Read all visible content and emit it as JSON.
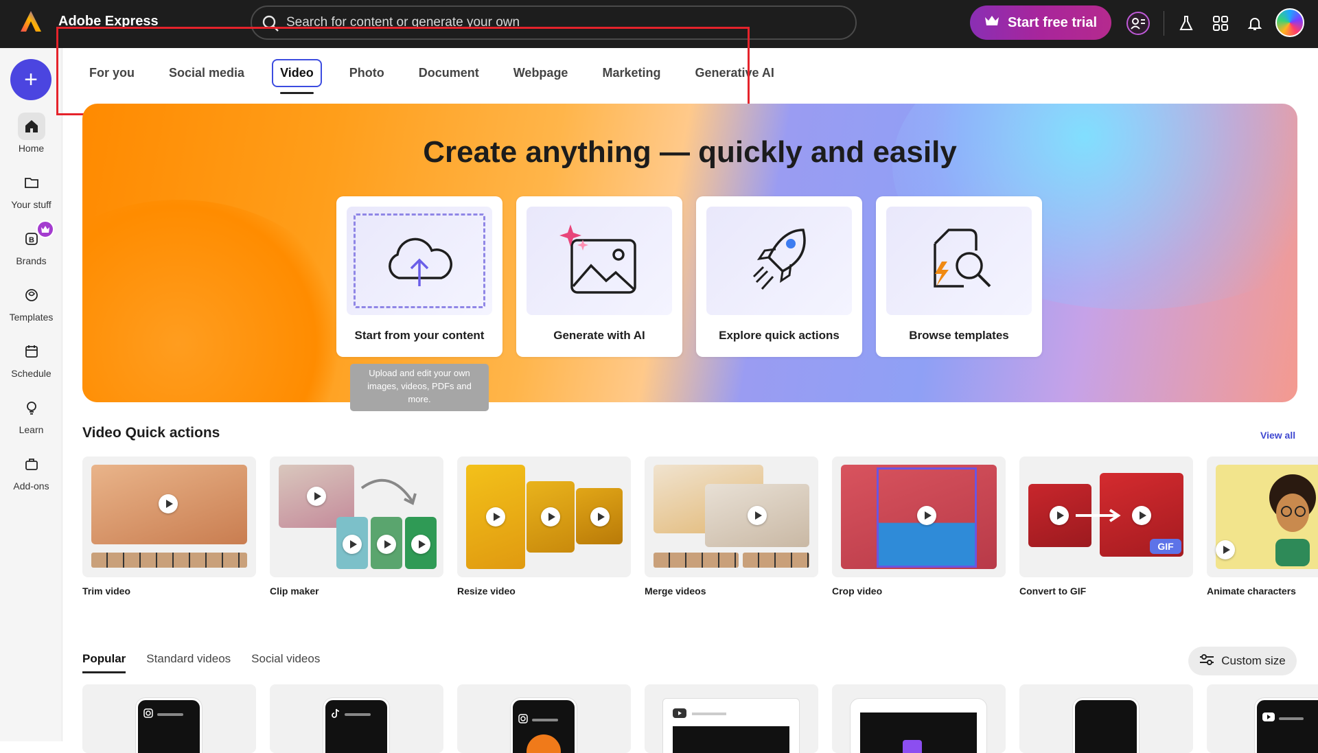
{
  "app": {
    "title": "Adobe Express"
  },
  "search": {
    "placeholder": "Search for content or generate your own"
  },
  "header": {
    "trial_label": "Start free trial"
  },
  "rail": {
    "create_label": "+",
    "items": [
      {
        "label": "Home",
        "icon": "home-icon"
      },
      {
        "label": "Your stuff",
        "icon": "folder-icon"
      },
      {
        "label": "Brands",
        "icon": "brand-icon"
      },
      {
        "label": "Templates",
        "icon": "templates-icon"
      },
      {
        "label": "Schedule",
        "icon": "calendar-icon"
      },
      {
        "label": "Learn",
        "icon": "lightbulb-icon"
      },
      {
        "label": "Add-ons",
        "icon": "addons-icon"
      }
    ]
  },
  "tabs": [
    "For you",
    "Social media",
    "Video",
    "Photo",
    "Document",
    "Webpage",
    "Marketing",
    "Generative AI"
  ],
  "active_tab": "Video",
  "hero": {
    "title": "Create anything — quickly and easily",
    "cards": [
      {
        "label": "Start from your content",
        "icon": "cloud-upload-icon"
      },
      {
        "label": "Generate with AI",
        "icon": "ai-image-icon"
      },
      {
        "label": "Explore quick actions",
        "icon": "rocket-icon"
      },
      {
        "label": "Browse templates",
        "icon": "template-search-icon"
      }
    ],
    "tooltip": "Upload and edit your own images, videos, PDFs and more."
  },
  "quick_actions": {
    "title": "Video Quick actions",
    "view_all": "View all",
    "items": [
      {
        "label": "Trim video"
      },
      {
        "label": "Clip maker"
      },
      {
        "label": "Resize video"
      },
      {
        "label": "Merge videos"
      },
      {
        "label": "Crop video"
      },
      {
        "label": "Convert to GIF",
        "badge": "GIF"
      },
      {
        "label": "Animate characters"
      }
    ]
  },
  "template_tabs": [
    "Popular",
    "Standard videos",
    "Social videos"
  ],
  "active_template_tab": "Popular",
  "custom_size_label": "Custom size",
  "colors": {
    "accent": "#4b45e0",
    "trial_gradient_start": "#8a2fb4",
    "highlight_box": "#e5232b"
  }
}
